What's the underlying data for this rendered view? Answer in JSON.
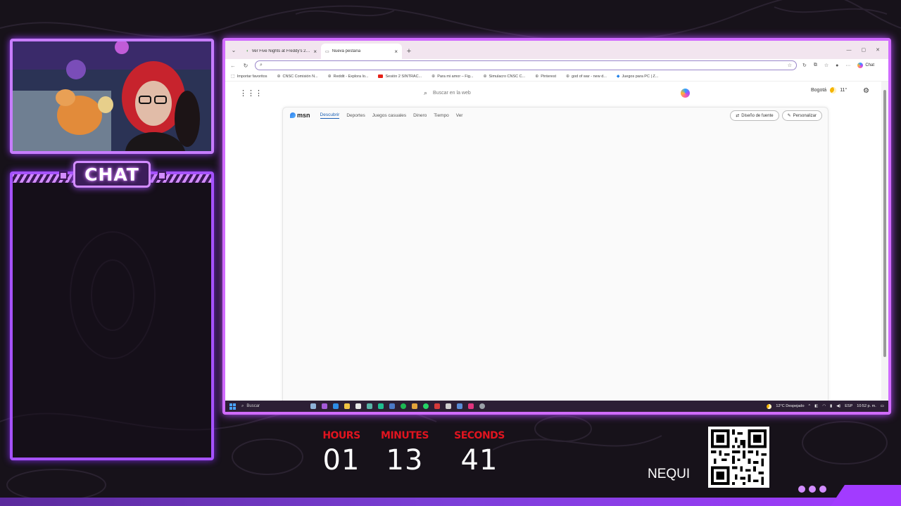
{
  "chat": {
    "label": "CHAT"
  },
  "browser": {
    "tabs": [
      {
        "title": "Ver Five Nights at Freddy's 2 (2023",
        "active": false
      },
      {
        "title": "Nueva pestaña",
        "active": true
      }
    ],
    "address": {
      "value": ""
    },
    "favorites": [
      {
        "label": "Importar favoritos",
        "icon": "import-icon"
      },
      {
        "label": "CNSC Comisión N...",
        "icon": "globe-icon"
      },
      {
        "label": "Reddit - Explora lo...",
        "icon": "globe-icon"
      },
      {
        "label": "Sesión 2 SINTRAC...",
        "icon": "youtube-icon"
      },
      {
        "label": "Para mi amor – Fig...",
        "icon": "globe-icon"
      },
      {
        "label": "Simulacro CNSC C...",
        "icon": "globe-icon"
      },
      {
        "label": "Pinterest",
        "icon": "globe-icon"
      },
      {
        "label": "god of war - new d...",
        "icon": "globe-icon"
      },
      {
        "label": "Juegos para PC | Z...",
        "icon": "game-icon"
      }
    ],
    "toolbar": {
      "chat_label": "Chat"
    }
  },
  "newtab": {
    "search_placeholder": "Buscar en la web",
    "weather": {
      "city": "Bogotá",
      "temp": "11°"
    },
    "msn": {
      "logo": "msn",
      "tabs": [
        "Descubrir",
        "Deportes",
        "Juegos casuales",
        "Dinero",
        "Tiempo",
        "Ver"
      ],
      "active_tab": "Descubrir",
      "actions": [
        "Diseño de fuente",
        "Personalizar"
      ]
    }
  },
  "taskbar": {
    "search_label": "Buscar",
    "weather": "12°C Despejado",
    "lang": "ESP",
    "time": "10:52 p. m."
  },
  "timer": {
    "hours_label": "HOURS",
    "hours": "01",
    "minutes_label": "MINUTES",
    "minutes": "13",
    "seconds_label": "SECONDS",
    "seconds": "41"
  },
  "donation": {
    "label": "NEQUI"
  },
  "colors": {
    "accent": "#d06bff",
    "timer_label": "#e0141f",
    "chat_border": "#a652ff"
  }
}
